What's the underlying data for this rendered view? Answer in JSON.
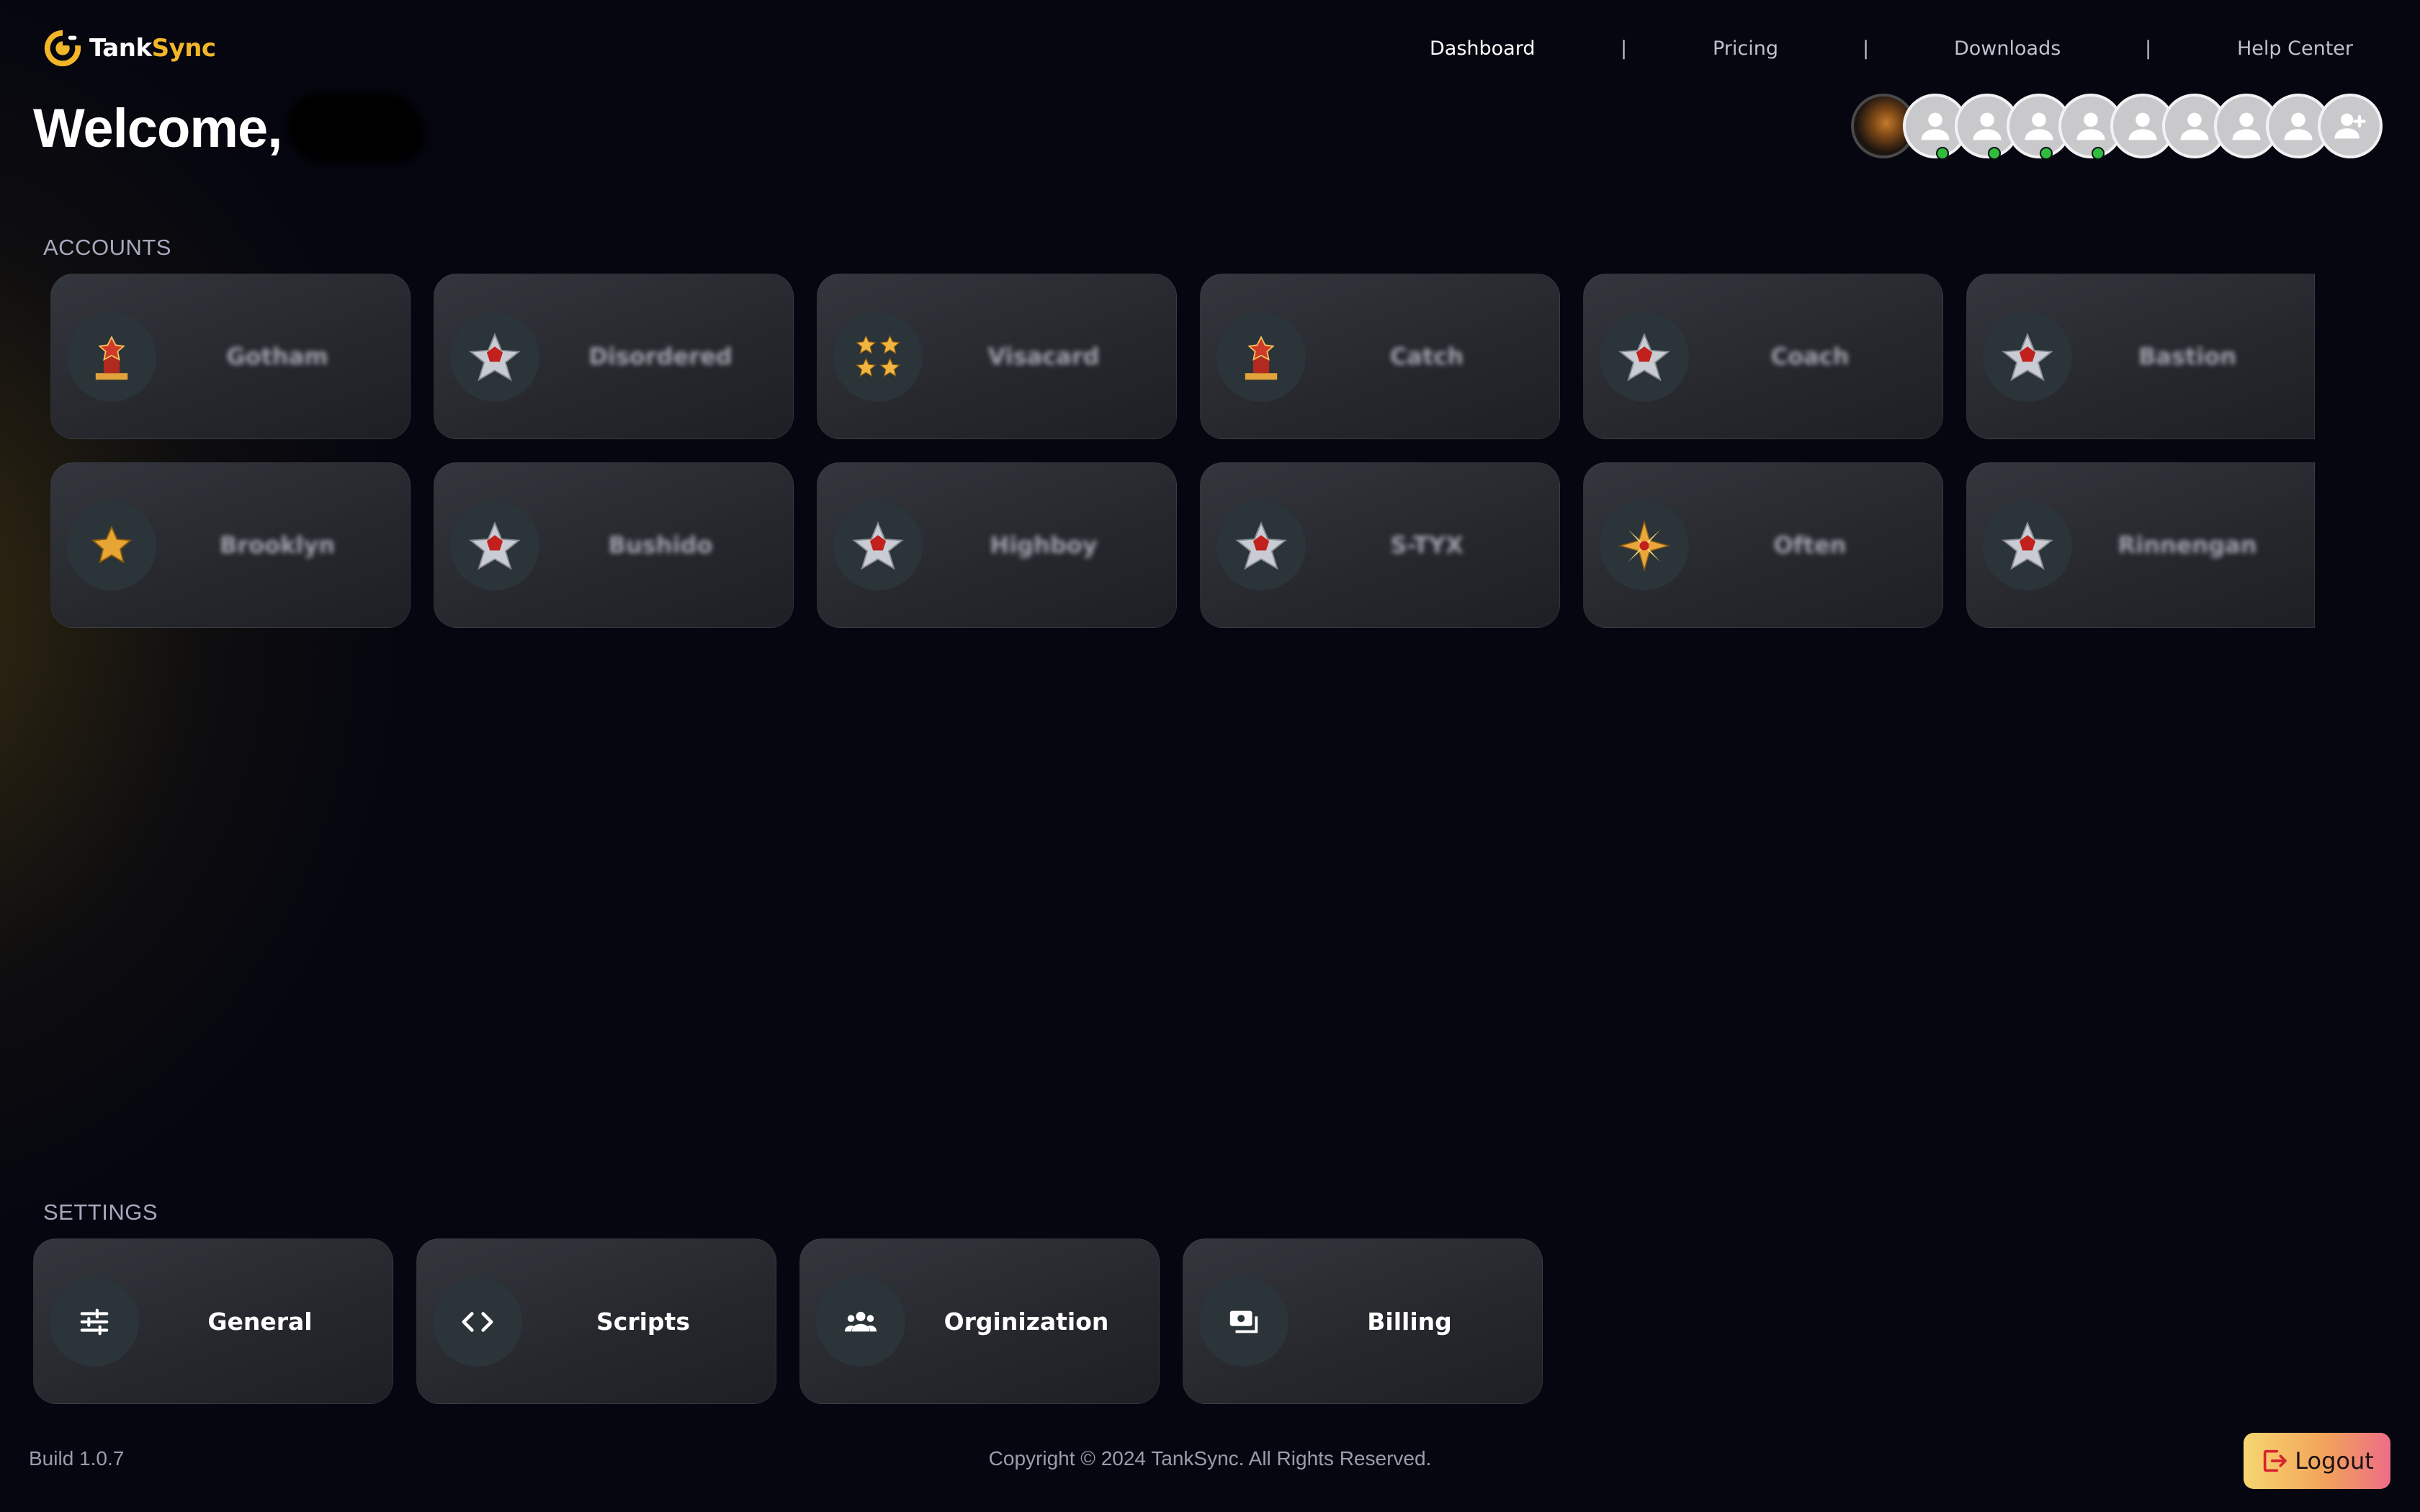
{
  "brand": {
    "name_part1": "Tank",
    "name_part2": "Sync"
  },
  "nav": {
    "items": [
      {
        "label": "Dashboard",
        "active": true
      },
      {
        "label": "Pricing",
        "active": false
      },
      {
        "label": "Downloads",
        "active": false
      },
      {
        "label": "Help Center",
        "active": false
      }
    ],
    "separator": "|"
  },
  "welcome": {
    "text": "Welcome,"
  },
  "accounts": {
    "title": "ACCOUNTS",
    "items": [
      {
        "name": "Gotham",
        "rank_icon": "podium-rank-icon"
      },
      {
        "name": "Disordered",
        "rank_icon": "star-emblem-icon"
      },
      {
        "name": "Visacard",
        "rank_icon": "four-stars-icon"
      },
      {
        "name": "Catch",
        "rank_icon": "podium-rank-icon"
      },
      {
        "name": "Coach",
        "rank_icon": "star-emblem-icon"
      },
      {
        "name": "Bastion",
        "rank_icon": "star-emblem-icon"
      },
      {
        "name": "Brooklyn",
        "rank_icon": "gold-star-icon"
      },
      {
        "name": "Bushido",
        "rank_icon": "star-emblem-icon"
      },
      {
        "name": "Highboy",
        "rank_icon": "star-emblem-icon"
      },
      {
        "name": "S-TYX",
        "rank_icon": "star-emblem-icon"
      },
      {
        "name": "Often",
        "rank_icon": "compass-star-icon"
      },
      {
        "name": "Rinnengan",
        "rank_icon": "star-emblem-icon"
      }
    ]
  },
  "settings": {
    "title": "SETTINGS",
    "items": [
      {
        "label": "General",
        "icon": "sliders-icon"
      },
      {
        "label": "Scripts",
        "icon": "code-icon"
      },
      {
        "label": "Orginization",
        "icon": "group-icon"
      },
      {
        "label": "Billing",
        "icon": "billing-icon"
      }
    ]
  },
  "team": {
    "members": [
      {
        "type": "photo",
        "online": false
      },
      {
        "type": "placeholder",
        "online": true
      },
      {
        "type": "placeholder",
        "online": true
      },
      {
        "type": "placeholder",
        "online": true
      },
      {
        "type": "placeholder",
        "online": true
      },
      {
        "type": "placeholder",
        "online": false
      },
      {
        "type": "placeholder",
        "online": false
      },
      {
        "type": "placeholder",
        "online": false
      },
      {
        "type": "placeholder",
        "online": false
      }
    ],
    "add_icon": "add-user-icon"
  },
  "footer": {
    "build": "Build 1.0.7",
    "copyright": "Copyright © 2024 TankSync. All Rights Reserved.",
    "logout_label": "Logout"
  },
  "colors": {
    "accent": "#f2b629",
    "background": "#05060f",
    "card": "#2a2c32",
    "online": "#2fbd3b"
  }
}
